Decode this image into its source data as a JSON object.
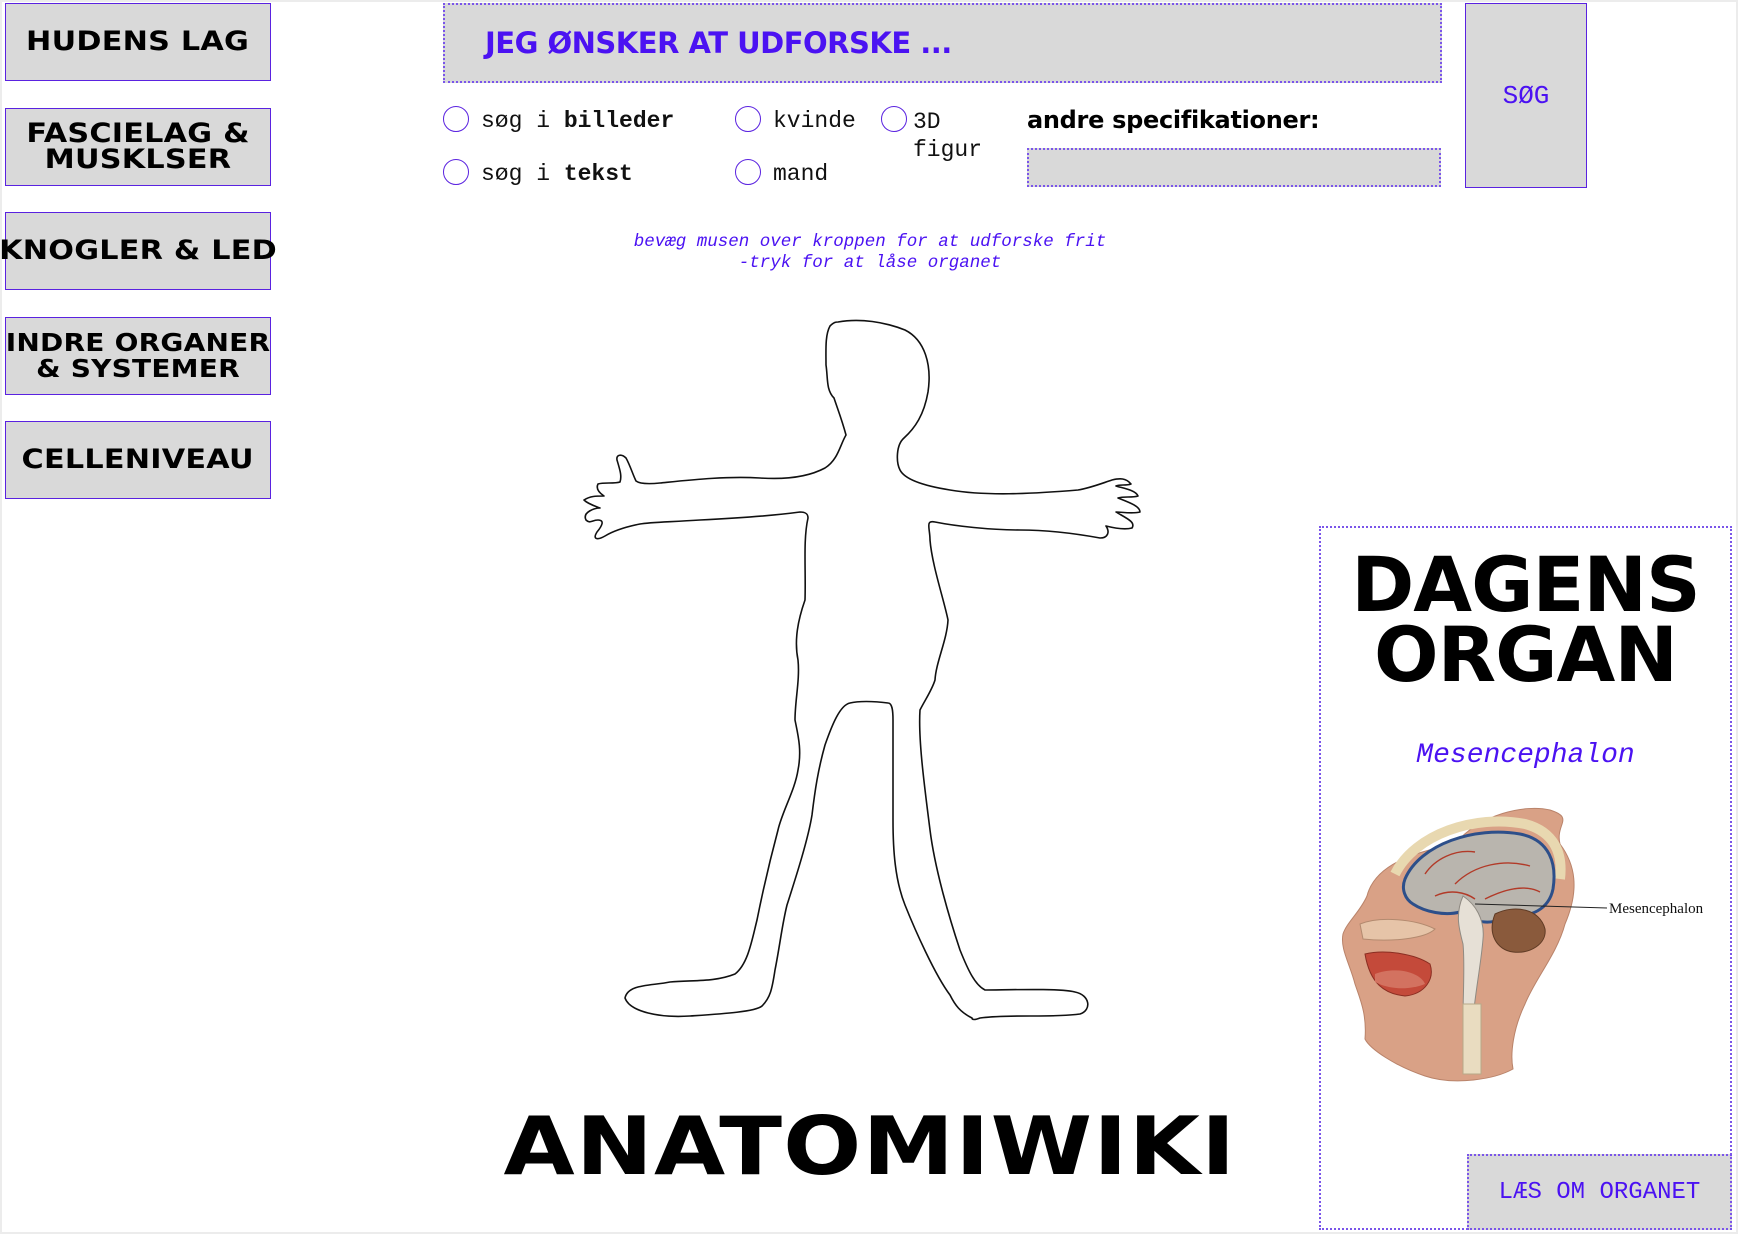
{
  "sidebar": {
    "items": [
      {
        "label": "HUDENS LAG"
      },
      {
        "label": "FASCIELAG & MUSKLSER"
      },
      {
        "label": "KNOGLER & LED"
      },
      {
        "label": "INDRE ORGANER & SYSTEMER"
      },
      {
        "label": "CELLENIVEAU"
      }
    ]
  },
  "search": {
    "placeholder": "JEG ØNSKER AT UDFORSKE ...",
    "button_label": "SØG"
  },
  "filters": {
    "images_prefix": "søg i ",
    "images_bold": "billeder",
    "text_prefix": "søg i ",
    "text_bold": "tekst",
    "female": "kvinde",
    "male": "mand",
    "figure_3d_line1": "3D",
    "figure_3d_line2": "figur"
  },
  "specifications": {
    "label": "andre specifikationer:"
  },
  "hint": {
    "line1": "bevæg musen over kroppen for at udforske frit",
    "line2": "-tryk for at låse organet"
  },
  "site_title": "ANATOMIWIKI",
  "organ_of_day": {
    "heading_line1": "DAGENS",
    "heading_line2": "ORGAN",
    "organ_name": "Mesencephalon",
    "image_label": "Mesencephalon",
    "read_button": "LÆS OM ORGANET"
  },
  "colors": {
    "accent": "#4b12f2",
    "button_bg": "#d9d9d9",
    "border": "#5a22e0"
  }
}
